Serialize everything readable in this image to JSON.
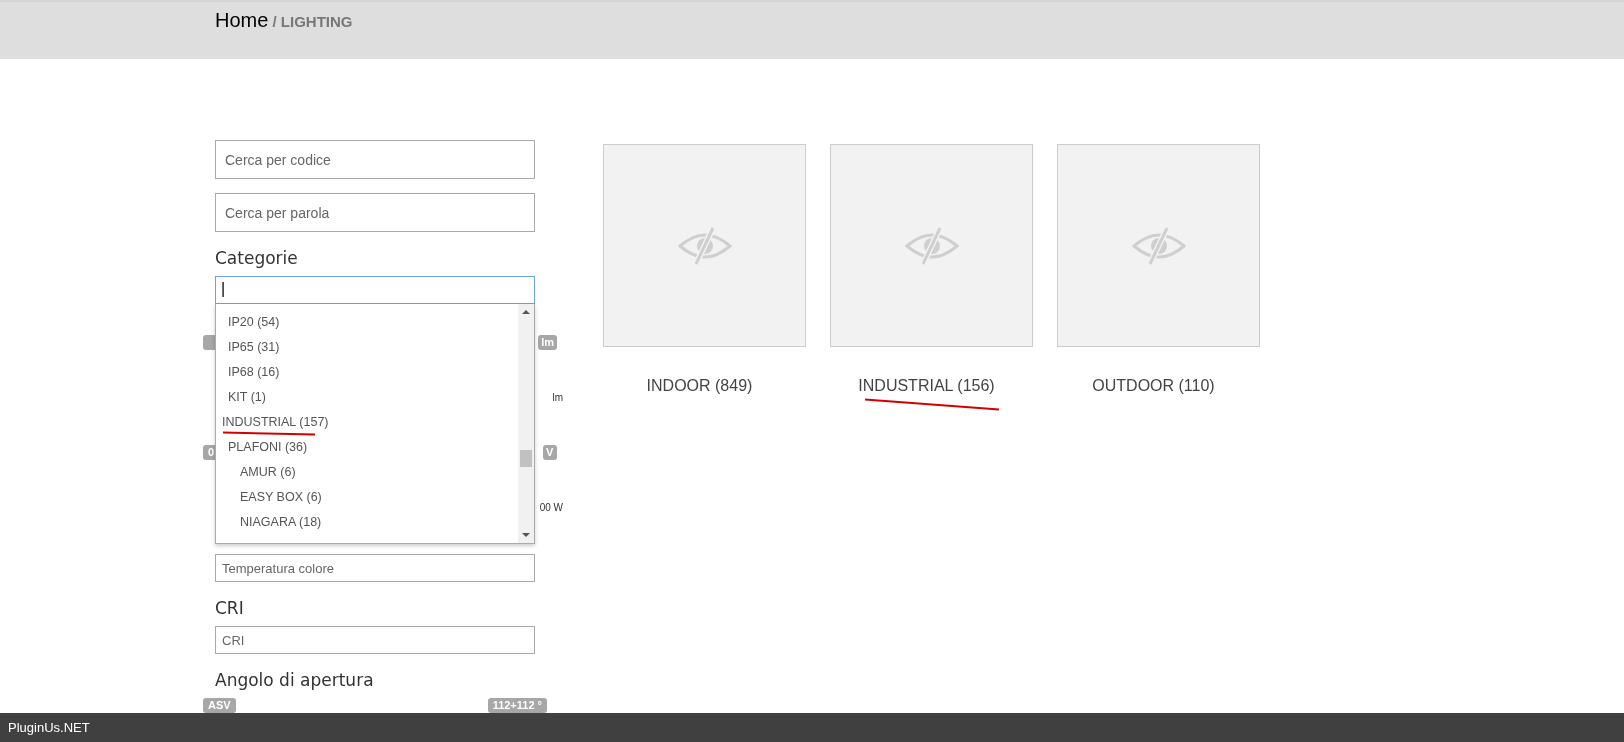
{
  "breadcrumb": {
    "home": "Home",
    "current": "/ LIGHTING"
  },
  "search_fields": [
    {
      "placeholder": "Cerca per codice"
    },
    {
      "placeholder": "Cerca per parola"
    }
  ],
  "categories": {
    "label": "Categorie",
    "value": "|",
    "options": [
      {
        "children": [
          {
            "label": "IP20 (54)",
            "marked": false
          },
          {
            "label": "IP65 (31)",
            "marked": false
          },
          {
            "label": "IP68 (16)",
            "marked": false
          },
          {
            "label": "KIT (1)",
            "marked": false
          }
        ]
      },
      {
        "label": "INDUSTRIAL (157)",
        "marked": true,
        "children": [
          {
            "label": "PLAFONI (36)",
            "marked": false,
            "children": [
              {
                "label": "AMUR (6)",
                "marked": false
              },
              {
                "label": "EASY BOX (6)",
                "marked": false
              },
              {
                "label": "NIAGARA (18)",
                "marked": false
              }
            ]
          }
        ]
      }
    ]
  },
  "hidden_filters": [
    {
      "left": {
        "kind": "badge"
      },
      "right": {
        "kind": "badge",
        "text": "lm"
      }
    },
    {
      "right": {
        "kind": "plain",
        "text": "lm"
      }
    },
    {
      "left": {
        "kind": "badge",
        "text": "0"
      },
      "right": {
        "kind": "badge",
        "text": "V"
      }
    },
    {
      "right": {
        "kind": "plain",
        "text": "00 W"
      }
    }
  ],
  "temperature_field": {
    "placeholder": "Temperatura colore"
  },
  "cri": {
    "label": "CRI",
    "placeholder": "CRI"
  },
  "angle": {
    "label": "Angolo di apertura",
    "min": "ASV",
    "max": "112+112 °"
  },
  "cards": [
    {
      "label": "INDOOR (849)",
      "marked": false
    },
    {
      "label": "INDUSTRIAL (156)",
      "marked": true
    },
    {
      "label": "OUTDOOR (110)",
      "marked": false
    }
  ],
  "footer": {
    "text": "PluginUs.NET"
  }
}
